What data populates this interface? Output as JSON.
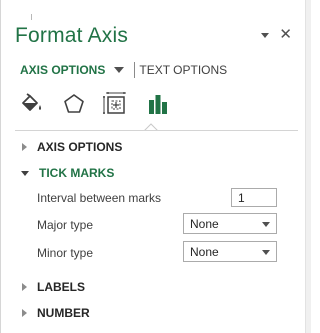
{
  "pane": {
    "title": "Format Axis",
    "tabs": {
      "axis_options": "AXIS OPTIONS",
      "text_options": "TEXT OPTIONS"
    },
    "icons": [
      "fill-line-icon",
      "effects-icon",
      "size-properties-icon",
      "axis-options-bar-chart-icon"
    ],
    "accent_color": "#217346"
  },
  "sections": {
    "axis_options": "AXIS OPTIONS",
    "tick_marks": "TICK MARKS",
    "labels": "LABELS",
    "number": "NUMBER"
  },
  "tick_marks": {
    "interval_label": "Interval between marks",
    "interval_value": "1",
    "major_label": "Major type",
    "major_value": "None",
    "minor_label": "Minor type",
    "minor_value": "None"
  }
}
